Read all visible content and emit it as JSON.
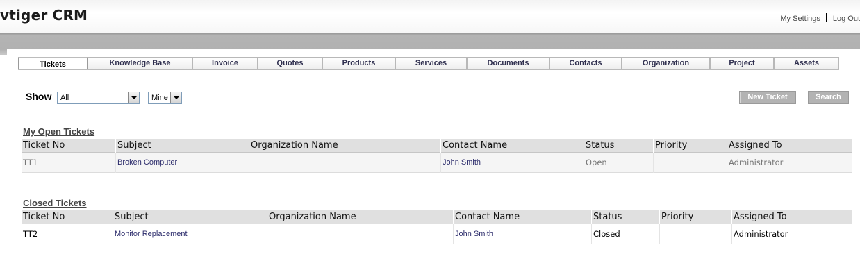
{
  "header": {
    "logo": "vtiger CRM",
    "links": {
      "settings": "My Settings",
      "logout": "Log Out"
    }
  },
  "tabs": [
    {
      "label": "Tickets",
      "active": true
    },
    {
      "label": "Knowledge Base"
    },
    {
      "label": "Invoice"
    },
    {
      "label": "Quotes"
    },
    {
      "label": "Products"
    },
    {
      "label": "Services"
    },
    {
      "label": "Documents"
    },
    {
      "label": "Contacts"
    },
    {
      "label": "Organization"
    },
    {
      "label": "Project"
    },
    {
      "label": "Assets"
    }
  ],
  "filters": {
    "show_label": "Show",
    "show_select": "All",
    "owner_select": "Mine"
  },
  "buttons": {
    "new_ticket": "New Ticket",
    "search": "Search"
  },
  "open_tickets": {
    "title": "My Open Tickets",
    "columns": [
      "Ticket No",
      "Subject",
      "Organization Name",
      "Contact Name",
      "Status",
      "Priority",
      "Assigned To"
    ],
    "rows": [
      {
        "ticket_no": "TT1",
        "subject": "Broken Computer",
        "organization": "",
        "contact": "John Smith",
        "status": "Open",
        "priority": "",
        "assigned_to": "Administrator"
      }
    ]
  },
  "closed_tickets": {
    "title": "Closed Tickets",
    "columns": [
      "Ticket No",
      "Subject",
      "Organization Name",
      "Contact Name",
      "Status",
      "Priority",
      "Assigned To"
    ],
    "rows": [
      {
        "ticket_no": "TT2",
        "subject": "Monitor Replacement",
        "organization": "",
        "contact": "John Smith",
        "status": "Closed",
        "priority": "",
        "assigned_to": "Administrator"
      }
    ]
  }
}
